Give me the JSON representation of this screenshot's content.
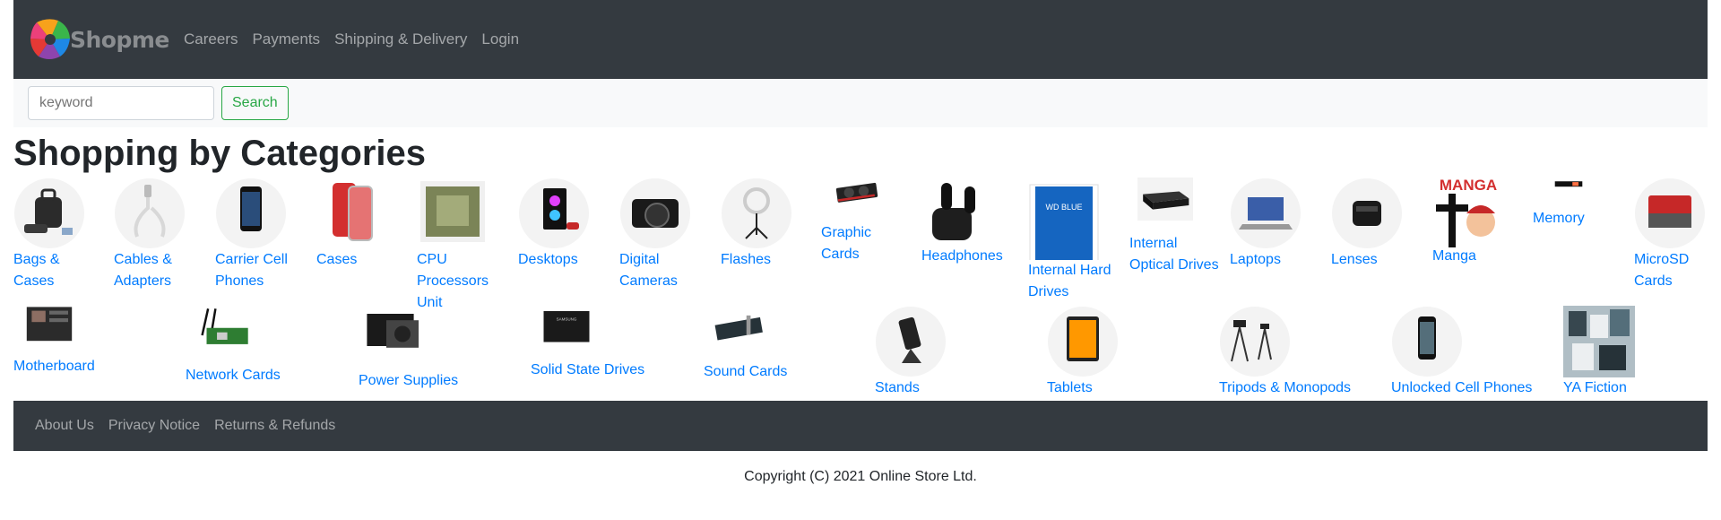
{
  "brand": {
    "name": "Shopme"
  },
  "nav": {
    "links": [
      "Careers",
      "Payments",
      "Shipping & Delivery",
      "Login"
    ]
  },
  "search": {
    "placeholder": "keyword",
    "button_label": "Search"
  },
  "page_title": "Shopping by Categories",
  "categories_row1": [
    {
      "label": "Bags & Cases",
      "icon": "bag-icon"
    },
    {
      "label": "Cables & Adapters",
      "icon": "cable-icon"
    },
    {
      "label": "Carrier Cell Phones",
      "icon": "phone-icon"
    },
    {
      "label": "Cases",
      "icon": "phone-case-icon"
    },
    {
      "label": "CPU Processors Unit",
      "icon": "cpu-icon"
    },
    {
      "label": "Desktops",
      "icon": "desktop-icon"
    },
    {
      "label": "Digital Cameras",
      "icon": "camera-icon"
    },
    {
      "label": "Flashes",
      "icon": "ring-light-icon"
    },
    {
      "label": "Graphic Cards",
      "icon": "graphics-card-icon"
    },
    {
      "label": "Headphones",
      "icon": "earbuds-icon"
    },
    {
      "label": "Internal Hard Drives",
      "icon": "hard-drive-icon"
    },
    {
      "label": "Internal Optical Drives",
      "icon": "optical-drive-icon"
    },
    {
      "label": "Laptops",
      "icon": "laptop-icon"
    },
    {
      "label": "Lenses",
      "icon": "lens-icon"
    },
    {
      "label": "Manga",
      "icon": "manga-icon"
    },
    {
      "label": "Memory",
      "icon": "ssd-stick-icon"
    },
    {
      "label": "MicroSD Cards",
      "icon": "microsd-icon"
    }
  ],
  "categories_row2": [
    {
      "label": "Motherboard",
      "icon": "motherboard-icon"
    },
    {
      "label": "Network Cards",
      "icon": "network-card-icon"
    },
    {
      "label": "Power Supplies",
      "icon": "power-supply-icon"
    },
    {
      "label": "Solid State Drives",
      "icon": "ssd-icon"
    },
    {
      "label": "Sound Cards",
      "icon": "sound-card-icon"
    },
    {
      "label": "Stands",
      "icon": "stand-icon"
    },
    {
      "label": "Tablets",
      "icon": "tablet-icon"
    },
    {
      "label": "Tripods & Monopods",
      "icon": "tripod-icon"
    },
    {
      "label": "Unlocked Cell Phones",
      "icon": "phone-icon"
    },
    {
      "label": "YA Fiction",
      "icon": "books-icon"
    }
  ],
  "footer": {
    "links": [
      "About Us",
      "Privacy Notice",
      "Returns & Refunds"
    ]
  },
  "copyright": "Copyright (C) 2021 Online Store Ltd."
}
